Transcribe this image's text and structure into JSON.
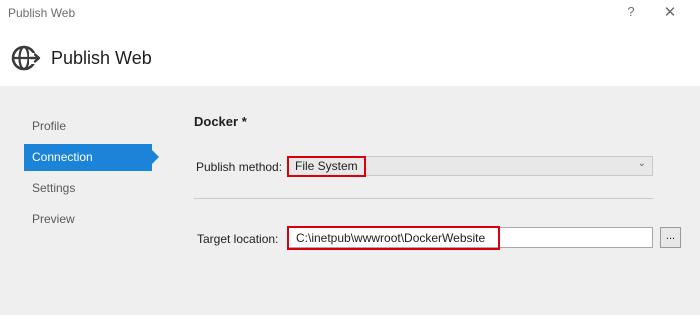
{
  "window": {
    "title": "Publish Web",
    "help_glyph": "?",
    "close_glyph": "✕"
  },
  "header": {
    "title": "Publish Web",
    "icon": "globe-icon"
  },
  "nav": {
    "items": [
      {
        "label": "Profile",
        "active": false
      },
      {
        "label": "Connection",
        "active": true
      },
      {
        "label": "Settings",
        "active": false
      },
      {
        "label": "Preview",
        "active": false
      }
    ]
  },
  "section": {
    "title": "Docker *"
  },
  "publish_method": {
    "label": "Publish method:",
    "value": "File System"
  },
  "target_location": {
    "label": "Target location:",
    "value": "C:\\inetpub\\wwwroot\\DockerWebsite",
    "browse_label": "..."
  },
  "colors": {
    "accent": "#1c84d8",
    "highlight": "#d9000d",
    "panel": "#efefef"
  }
}
